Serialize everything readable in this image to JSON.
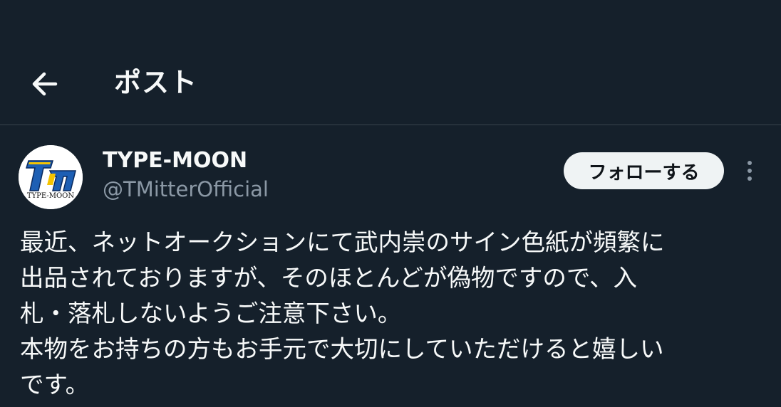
{
  "header": {
    "title": "ポスト"
  },
  "author": {
    "name": "TYPE-MOON",
    "handle": "@TMitterOfficial",
    "avatar_text": "TYPE-MOON",
    "avatar_logo": "TM"
  },
  "actions": {
    "follow_label": "フォローする"
  },
  "post": {
    "lines": [
      "最近、ネットオークションにて武内崇のサイン色紙が頻繁に",
      "出品されておりますが、そのほとんどが偽物ですので、入",
      "札・落札しないようご注意下さい。",
      "本物をお持ちの方もお手元で大切にしていただけると嬉しい",
      "です。"
    ]
  },
  "colors": {
    "background": "#15202b",
    "divider": "#38444d",
    "text_primary": "#f7f9f9",
    "text_secondary": "#8b98a5",
    "follow_bg": "#eff3f4",
    "logo_blue": "#1d5fb4",
    "logo_yellow": "#f5c400"
  },
  "icons": {
    "back": "arrow-left-icon",
    "more": "more-vertical-icon"
  }
}
